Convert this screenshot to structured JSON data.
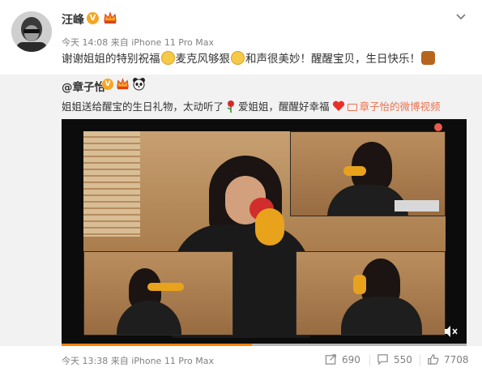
{
  "post": {
    "username": "汪峰",
    "meta": "今天 14:08 来自 iPhone 11 Pro Max",
    "text_1": "谢谢姐姐的特别祝福",
    "text_2": "麦克风够狠",
    "text_3": "和声很美妙！醒醒宝贝，生日快乐！"
  },
  "repost": {
    "username": "@章子怡",
    "text_1": "姐姐送给醒宝的生日礼物，太动听了",
    "text_2": "爱姐姐，醒醒好幸福",
    "link": "章子怡的微博视频"
  },
  "video": {
    "progress_fraction": 0.47
  },
  "footer": {
    "meta": "今天 13:38 来自 iPhone 11 Pro Max",
    "repost_count": "690",
    "comment_count": "550",
    "like_count": "7708"
  },
  "icons": {
    "vip_badge": "v-badge-icon",
    "crown": "crown-icon",
    "panda": "panda-icon",
    "chevron": "chevron-down-icon",
    "repost": "repost-icon",
    "comment": "comment-icon",
    "like": "like-icon",
    "mute": "mute-icon"
  },
  "colors": {
    "link": "#eb7350",
    "badge": "#f5a623",
    "progress": "#ff8200"
  }
}
